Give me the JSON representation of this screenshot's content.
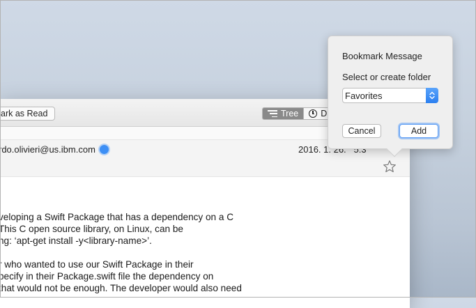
{
  "toolbar": {
    "mark_read_label": "ark as Read",
    "tree_label": "Tree",
    "date_label": "D"
  },
  "message": {
    "sender": "rdo.olivieri@us.ibm.com",
    "date": "2016. 1. 26.   5:3",
    "body_lines": [
      "veloping a Swift Package that has a dependency on a C",
      " This C open source library, on Linux, can be",
      "ng: ‘apt-get install -y<library-name>’.",
      "",
      "r who wanted to use our Swift Package in their",
      "pecify in their Package.swift file the dependency on",
      "that would not be enough. The developer would also need",
      "                                               "
    ]
  },
  "popover": {
    "title": "Bookmark Message",
    "folder_label": "Select or create folder",
    "folder_value": "Favorites",
    "cancel_label": "Cancel",
    "add_label": "Add"
  },
  "icons": {
    "tree": "tree-view-icon",
    "date": "clock-icon",
    "verified": "verified-badge-icon",
    "star": "star-icon",
    "select": "chevron-updown-icon"
  },
  "colors": {
    "accent": "#2b7ff0",
    "verified": "#3d8ff5",
    "tree_selected": "#8a8a8a"
  }
}
